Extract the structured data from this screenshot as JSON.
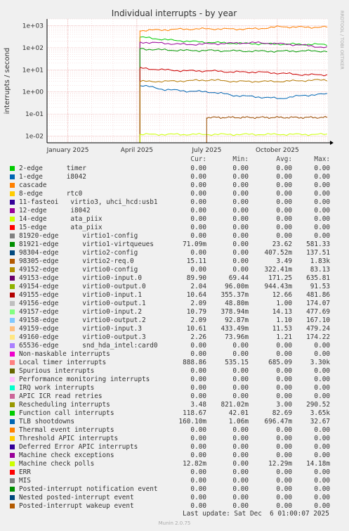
{
  "chart_data": {
    "type": "line",
    "title": "Individual interrupts - by year",
    "ylabel": "interrupts / second",
    "y_scale": "log",
    "ylim": [
      0.005,
      2000
    ],
    "y_ticks": [
      "1e-02",
      "1e-01",
      "1e+00",
      "1e+01",
      "1e+02",
      "1e+03"
    ],
    "x_ticks": [
      "January 2025",
      "April 2025",
      "July 2025",
      "October 2025"
    ],
    "side_text": "RRDTOOL / TOBI OETIKER",
    "grid": true,
    "series_approx": [
      {
        "name": "Local timer interrupts",
        "color": "#00cc00",
        "start": "2025-04-05",
        "level": 300,
        "trend": [
          300,
          220,
          180,
          160,
          150,
          145,
          140
        ]
      },
      {
        "name": "Function call interrupts",
        "color": "#0066b3",
        "start": "2025-04-05",
        "level": 5,
        "trend": [
          2,
          1.3,
          1.1,
          1.0,
          0.7,
          0.6,
          0.5,
          0.7,
          0.8
        ]
      },
      {
        "name": "TLB shootdowns",
        "color": "#ff8000",
        "start": "2025-04-05",
        "level": 500,
        "trend": [
          600,
          650,
          700,
          720,
          700,
          720,
          900,
          850,
          860
        ]
      },
      {
        "name": "virtio0-input.0",
        "color": "#990099",
        "start": "2025-04-05",
        "level": 150,
        "trend": [
          180,
          160,
          140,
          150,
          160,
          170,
          150,
          130,
          100
        ]
      },
      {
        "name": "virtio1-virtqueues",
        "color": "#009900",
        "start": "2025-04-05",
        "level": 80,
        "trend": [
          90,
          80,
          75,
          75,
          72,
          70,
          70,
          72,
          70
        ]
      },
      {
        "name": "virtio0-output.0",
        "color": "#cc0000",
        "start": "2025-04-05",
        "level": 15,
        "trend": [
          12,
          10,
          9,
          9,
          8,
          8,
          7,
          6,
          6
        ]
      },
      {
        "name": "Rescheduling interrupts",
        "color": "#b37800",
        "start": "2025-04-05",
        "level": 3,
        "trend": [
          3,
          3,
          3.2,
          3.5,
          3,
          3,
          3,
          3.3,
          3.5
        ]
      },
      {
        "name": "Machine check polls",
        "color": "#ccff00",
        "start": "2025-04-05",
        "level": 0.012,
        "trend": [
          0.012,
          0.012,
          0.012,
          0.012,
          0.012,
          0.012,
          0.012,
          0.012,
          0.012
        ]
      },
      {
        "name": "virtio2-req.0",
        "color": "#994c00",
        "start": "2025-07-01",
        "level": 0.07,
        "trend": [
          0.07,
          0.07,
          0.07,
          0.07,
          0.07,
          0.07
        ]
      }
    ]
  },
  "legend": {
    "headers": {
      "cur": "Cur:",
      "min": "Min:",
      "avg": "Avg:",
      "max": "Max:"
    },
    "rows": [
      {
        "color": "#00cc00",
        "label": "2-edge      timer",
        "cur": "0.00",
        "min": "0.00",
        "avg": "0.00",
        "max": "0.00"
      },
      {
        "color": "#0066b3",
        "label": "1-edge      i8042",
        "cur": "0.00",
        "min": "0.00",
        "avg": "0.00",
        "max": "0.00"
      },
      {
        "color": "#ff8000",
        "label": "cascade",
        "cur": "0.00",
        "min": "0.00",
        "avg": "0.00",
        "max": "0.00"
      },
      {
        "color": "#ffcc00",
        "label": "8-edge      rtc0",
        "cur": "0.00",
        "min": "0.00",
        "avg": "0.00",
        "max": "0.00"
      },
      {
        "color": "#330099",
        "label": "11-fasteoi   virtio3, uhci_hcd:usb1",
        "cur": "0.00",
        "min": "0.00",
        "avg": "0.00",
        "max": "0.00"
      },
      {
        "color": "#990099",
        "label": "12-edge      i8042",
        "cur": "0.00",
        "min": "0.00",
        "avg": "0.00",
        "max": "0.00"
      },
      {
        "color": "#ccff00",
        "label": "14-edge      ata_piix",
        "cur": "0.00",
        "min": "0.00",
        "avg": "0.00",
        "max": "0.00"
      },
      {
        "color": "#ff0000",
        "label": "15-edge      ata_piix",
        "cur": "0.00",
        "min": "0.00",
        "avg": "0.00",
        "max": "0.00"
      },
      {
        "color": "#808080",
        "label": "81920-edge      virtio1-config",
        "cur": "0.00",
        "min": "0.00",
        "avg": "0.00",
        "max": "0.00"
      },
      {
        "color": "#008f00",
        "label": "81921-edge      virtio1-virtqueues",
        "cur": "71.09m",
        "min": "0.00",
        "avg": "23.62",
        "max": "581.33"
      },
      {
        "color": "#00487d",
        "label": "98304-edge      virtio2-config",
        "cur": "0.00",
        "min": "0.00",
        "avg": "407.52m",
        "max": "137.51"
      },
      {
        "color": "#b35a00",
        "label": "98305-edge      virtio2-req.0",
        "cur": "15.11",
        "min": "0.00",
        "avg": "3.49",
        "max": "1.83k"
      },
      {
        "color": "#b38f00",
        "label": "49152-edge      virtio0-config",
        "cur": "0.00",
        "min": "0.00",
        "avg": "322.41m",
        "max": "83.13"
      },
      {
        "color": "#6b006b",
        "label": "49153-edge      virtio0-input.0",
        "cur": "89.90",
        "min": "69.44",
        "avg": "171.25",
        "max": "635.81"
      },
      {
        "color": "#8fb300",
        "label": "49154-edge      virtio0-output.0",
        "cur": "2.04",
        "min": "96.00m",
        "avg": "944.43m",
        "max": "91.53"
      },
      {
        "color": "#b30000",
        "label": "49155-edge      virtio0-input.1",
        "cur": "10.64",
        "min": "355.37m",
        "avg": "12.66",
        "max": "481.86"
      },
      {
        "color": "#bebebe",
        "label": "49156-edge      virtio0-output.1",
        "cur": "2.09",
        "min": "48.80m",
        "avg": "1.00",
        "max": "174.07"
      },
      {
        "color": "#80ff80",
        "label": "49157-edge      virtio0-input.2",
        "cur": "10.79",
        "min": "378.94m",
        "avg": "14.13",
        "max": "477.69"
      },
      {
        "color": "#80c9ff",
        "label": "49158-edge      virtio0-output.2",
        "cur": "2.09",
        "min": "92.87m",
        "avg": "1.10",
        "max": "167.10"
      },
      {
        "color": "#ffc080",
        "label": "49159-edge      virtio0-input.3",
        "cur": "10.61",
        "min": "433.49m",
        "avg": "11.53",
        "max": "479.24"
      },
      {
        "color": "#ffe680",
        "label": "49160-edge      virtio0-output.3",
        "cur": "2.26",
        "min": "73.96m",
        "avg": "1.21",
        "max": "174.22"
      },
      {
        "color": "#aa80ff",
        "label": "65536-edge      snd_hda_intel:card0",
        "cur": "0.00",
        "min": "0.00",
        "avg": "0.00",
        "max": "0.00"
      },
      {
        "color": "#ee00cc",
        "label": "Non-maskable interrupts",
        "cur": "0.00",
        "min": "0.00",
        "avg": "0.00",
        "max": "0.00"
      },
      {
        "color": "#ff8080",
        "label": "Local timer interrupts",
        "cur": "888.86",
        "min": "535.15",
        "avg": "685.09",
        "max": "3.30k"
      },
      {
        "color": "#666600",
        "label": "Spurious interrupts",
        "cur": "0.00",
        "min": "0.00",
        "avg": "0.00",
        "max": "0.00"
      },
      {
        "color": "#ffbfff",
        "label": "Performance monitoring interrupts",
        "cur": "0.00",
        "min": "0.00",
        "avg": "0.00",
        "max": "0.00"
      },
      {
        "color": "#00ffcc",
        "label": "IRQ work interrupts",
        "cur": "0.00",
        "min": "0.00",
        "avg": "0.00",
        "max": "0.00"
      },
      {
        "color": "#cc6699",
        "label": "APIC ICR read retries",
        "cur": "0.00",
        "min": "0.00",
        "avg": "0.00",
        "max": "0.00"
      },
      {
        "color": "#999900",
        "label": "Rescheduling interrupts",
        "cur": "3.48",
        "min": "821.02m",
        "avg": "3.00",
        "max": "290.52"
      },
      {
        "color": "#00cc00",
        "label": "Function call interrupts",
        "cur": "118.67",
        "min": "42.01",
        "avg": "82.69",
        "max": "3.65k"
      },
      {
        "color": "#0066b3",
        "label": "TLB shootdowns",
        "cur": "160.10m",
        "min": "1.06m",
        "avg": "696.47m",
        "max": "32.67"
      },
      {
        "color": "#ff8000",
        "label": "Thermal event interrupts",
        "cur": "0.00",
        "min": "0.00",
        "avg": "0.00",
        "max": "0.00"
      },
      {
        "color": "#ffcc00",
        "label": "Threshold APIC interrupts",
        "cur": "0.00",
        "min": "0.00",
        "avg": "0.00",
        "max": "0.00"
      },
      {
        "color": "#330099",
        "label": "Deferred Error APIC interrupts",
        "cur": "0.00",
        "min": "0.00",
        "avg": "0.00",
        "max": "0.00"
      },
      {
        "color": "#990099",
        "label": "Machine check exceptions",
        "cur": "0.00",
        "min": "0.00",
        "avg": "0.00",
        "max": "0.00"
      },
      {
        "color": "#ccff00",
        "label": "Machine check polls",
        "cur": "12.82m",
        "min": "0.00",
        "avg": "12.29m",
        "max": "14.18m"
      },
      {
        "color": "#ff0000",
        "label": "ERR",
        "cur": "0.00",
        "min": "0.00",
        "avg": "0.00",
        "max": "0.00"
      },
      {
        "color": "#808080",
        "label": "MIS",
        "cur": "0.00",
        "min": "0.00",
        "avg": "0.00",
        "max": "0.00"
      },
      {
        "color": "#008f00",
        "label": "Posted-interrupt notification event",
        "cur": "0.00",
        "min": "0.00",
        "avg": "0.00",
        "max": "0.00"
      },
      {
        "color": "#00487d",
        "label": "Nested posted-interrupt event",
        "cur": "0.00",
        "min": "0.00",
        "avg": "0.00",
        "max": "0.00"
      },
      {
        "color": "#b35a00",
        "label": "Posted-interrupt wakeup event",
        "cur": "0.00",
        "min": "0.00",
        "avg": "0.00",
        "max": "0.00"
      }
    ]
  },
  "footer": {
    "last_update": "Last update: Sat Dec  6 01:00:07 2025",
    "generator": "Munin 2.0.75"
  }
}
